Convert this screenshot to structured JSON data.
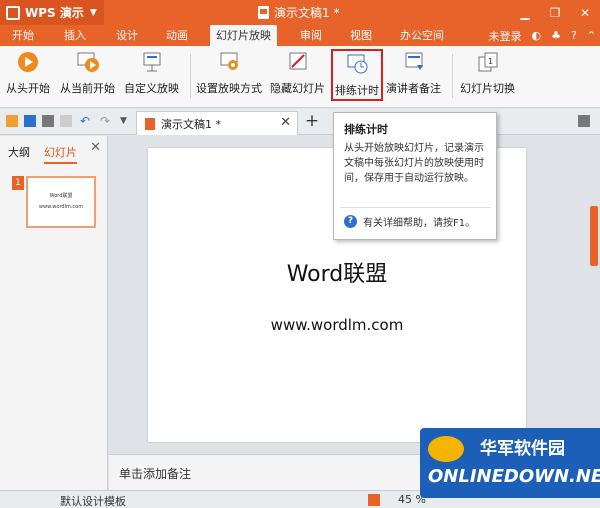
{
  "titlebar": {
    "app_name": "WPS 演示",
    "doc_title": "演示文稿1 *",
    "window_controls": [
      "minimize-icon",
      "maximize-icon",
      "close-icon"
    ]
  },
  "menu": {
    "items": [
      "开始",
      "插入",
      "设计",
      "动画",
      "幻灯片放映",
      "审阅",
      "视图",
      "办公空间"
    ],
    "active": "幻灯片放映",
    "login": "未登录"
  },
  "ribbon": {
    "buttons": [
      {
        "label": "从头开始",
        "icon": "play-from-start-icon"
      },
      {
        "label": "从当前开始",
        "icon": "play-from-current-icon"
      },
      {
        "label": "自定义放映",
        "icon": "custom-show-icon"
      },
      {
        "label": "设置放映方式",
        "icon": "setup-show-icon"
      },
      {
        "label": "隐藏幻灯片",
        "icon": "hide-slide-icon"
      },
      {
        "label": "排练计时",
        "icon": "rehearse-timing-icon",
        "highlighted": true
      },
      {
        "label": "演讲者备注",
        "icon": "speaker-notes-icon"
      },
      {
        "label": "幻灯片切换",
        "icon": "slide-transition-icon"
      }
    ]
  },
  "tabs": {
    "doc_tab": "演示文稿1 *",
    "new_tab": "+"
  },
  "left_panel": {
    "tab_outline": "大纲",
    "tab_slides": "幻灯片",
    "thumb_number": "1",
    "thumb_title": "Word联盟",
    "thumb_sub": "www.wordlm.com"
  },
  "slide": {
    "title": "Word联盟",
    "subtitle": "www.wordlm.com"
  },
  "notes": {
    "placeholder": "单击添加备注"
  },
  "statusbar": {
    "template": "默认设计模板",
    "zoom": "45 %"
  },
  "tooltip": {
    "title": "排练计时",
    "body": "从头开始放映幻灯片，记录演示文稿中每张幻灯片的放映使用时间，保存用于自动运行放映。",
    "help": "有关详细帮助，请按F1。"
  },
  "watermark": {
    "cn": "华军软件园",
    "en": "ONLINEDOWN.NET"
  },
  "colors": {
    "accent": "#e8632a",
    "highlight_border": "#d32020"
  }
}
